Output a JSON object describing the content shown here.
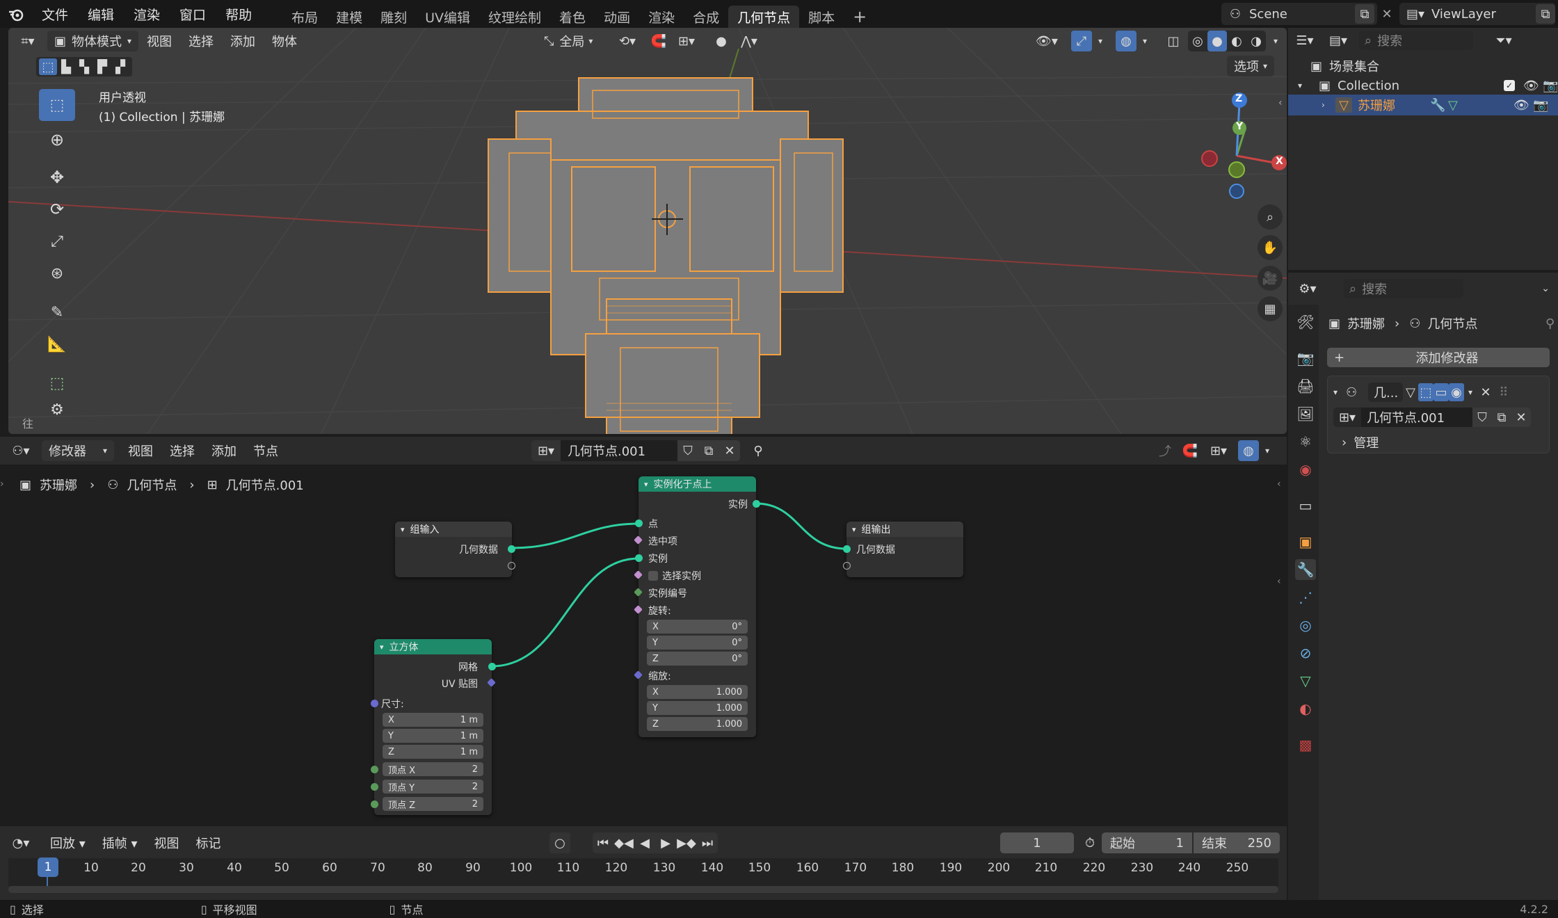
{
  "menu": {
    "file": "文件",
    "edit": "编辑",
    "render": "渲染",
    "window": "窗口",
    "help": "帮助"
  },
  "workspaces": [
    "布局",
    "建模",
    "雕刻",
    "UV编辑",
    "纹理绘制",
    "着色",
    "动画",
    "渲染",
    "合成",
    "几何节点",
    "脚本"
  ],
  "scene": {
    "name": "Scene",
    "viewlayer": "ViewLayer"
  },
  "viewport": {
    "mode": "物体模式",
    "menus": [
      "视图",
      "选择",
      "添加",
      "物体"
    ],
    "transform_orientation": "全局",
    "options": "选项",
    "overlay_title": "用户透视",
    "overlay_sub": "(1) Collection | 苏珊娜",
    "gizmo": {
      "z": "Z",
      "y": "Y",
      "x": "X"
    },
    "left_truncated": "往"
  },
  "outliner": {
    "search_placeholder": "搜索",
    "scene_collection": "场景集合",
    "collection": "Collection",
    "object": "苏珊娜"
  },
  "properties": {
    "search_placeholder": "搜索",
    "breadcrumb_obj": "苏珊娜",
    "breadcrumb_mod": "几何节点",
    "add_modifier": "添加修改器",
    "modifier_name": "几...",
    "node_group": "几何节点.001",
    "manage": "管理"
  },
  "node_editor": {
    "editor_type": "修改器",
    "menus": [
      "视图",
      "选择",
      "添加",
      "节点"
    ],
    "node_group": "几何节点.001",
    "breadcrumb": [
      "苏珊娜",
      "几何节点",
      "几何节点.001"
    ],
    "group_input": {
      "title": "组输入",
      "geometry": "几何数据"
    },
    "group_output": {
      "title": "组输出",
      "geometry": "几何数据"
    },
    "cube": {
      "title": "立方体",
      "mesh": "网格",
      "uv": "UV 贴图",
      "size": "尺寸:",
      "sx": {
        "l": "X",
        "v": "1 m"
      },
      "sy": {
        "l": "Y",
        "v": "1 m"
      },
      "sz": {
        "l": "Z",
        "v": "1 m"
      },
      "vx": {
        "l": "顶点 X",
        "v": "2"
      },
      "vy": {
        "l": "顶点 Y",
        "v": "2"
      },
      "vz": {
        "l": "顶点 Z",
        "v": "2"
      }
    },
    "instance_on_points": {
      "title": "实例化于点上",
      "instances": "实例",
      "points": "点",
      "selection": "选中项",
      "instance": "实例",
      "pick_instance": "选择实例",
      "instance_index": "实例编号",
      "rotation": "旋转:",
      "rx": {
        "l": "X",
        "v": "0°"
      },
      "ry": {
        "l": "Y",
        "v": "0°"
      },
      "rz": {
        "l": "Z",
        "v": "0°"
      },
      "scale": "缩放:",
      "scx": {
        "l": "X",
        "v": "1.000"
      },
      "scy": {
        "l": "Y",
        "v": "1.000"
      },
      "scz": {
        "l": "Z",
        "v": "1.000"
      }
    }
  },
  "timeline": {
    "playback": "回放",
    "keying": "插帧",
    "view": "视图",
    "marker": "标记",
    "current_frame": "1",
    "start_label": "起始",
    "start": "1",
    "end_label": "结束",
    "end": "250",
    "ticks": [
      "10",
      "20",
      "30",
      "40",
      "50",
      "60",
      "70",
      "80",
      "90",
      "100",
      "110",
      "120",
      "130",
      "140",
      "150",
      "160",
      "170",
      "180",
      "190",
      "200",
      "210",
      "220",
      "230",
      "240",
      "250"
    ],
    "playhead": "1"
  },
  "statusbar": {
    "select": "选择",
    "pan": "平移视图",
    "node": "节点",
    "version": "4.2.2"
  },
  "colors": {
    "accent": "#4772b3",
    "selection": "#f5a040",
    "node_teal": "#1e8a6a",
    "socket_green": "#2ed0a0"
  }
}
